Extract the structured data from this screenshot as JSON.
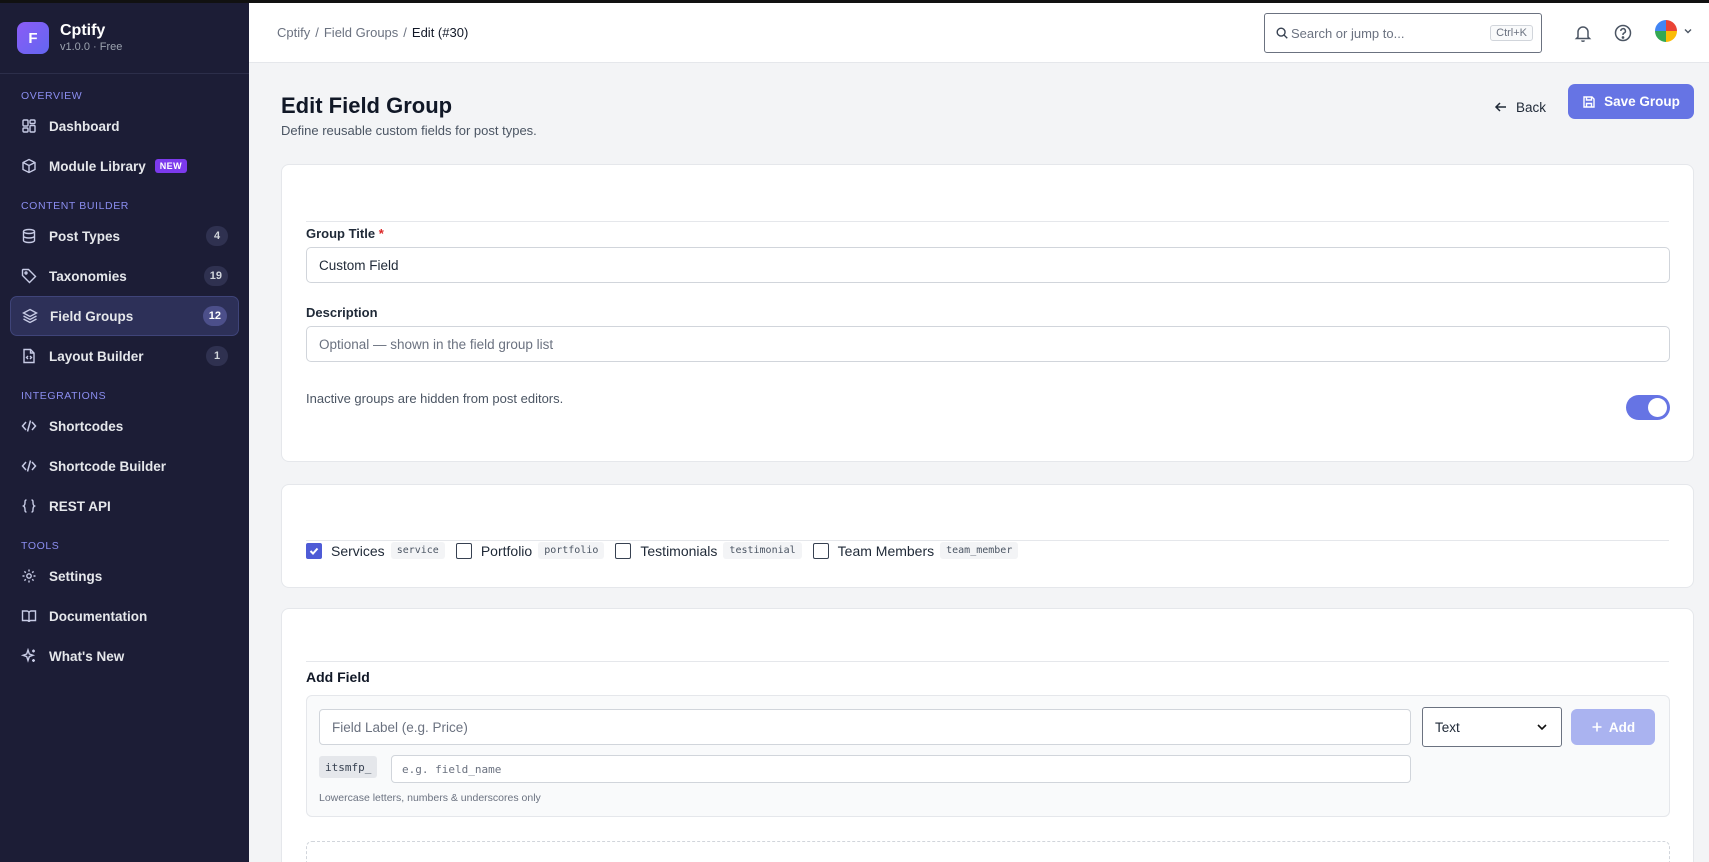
{
  "brand": {
    "logo_letter": "F",
    "name": "Cptify",
    "version": "v1.0.0 · Free"
  },
  "sidebar": {
    "sections": {
      "overview": "OVERVIEW",
      "content_builder": "CONTENT BUILDER",
      "integrations": "INTEGRATIONS",
      "tools": "TOOLS"
    },
    "items": {
      "dashboard": {
        "label": "Dashboard"
      },
      "module_library": {
        "label": "Module Library",
        "badge": "NEW"
      },
      "post_types": {
        "label": "Post Types",
        "count": "4"
      },
      "taxonomies": {
        "label": "Taxonomies",
        "count": "19"
      },
      "field_groups": {
        "label": "Field Groups",
        "count": "12"
      },
      "layout_builder": {
        "label": "Layout Builder",
        "count": "1"
      },
      "shortcodes": {
        "label": "Shortcodes"
      },
      "shortcode_builder": {
        "label": "Shortcode Builder"
      },
      "rest_api": {
        "label": "REST API"
      },
      "settings": {
        "label": "Settings"
      },
      "documentation": {
        "label": "Documentation"
      },
      "whats_new": {
        "label": "What's New"
      }
    }
  },
  "topbar": {
    "breadcrumbs": [
      "Cptify",
      "/",
      "Field Groups",
      "/",
      "Edit (#30)"
    ],
    "search_placeholder": "Search or jump to...",
    "search_shortcut": "Ctrl+K"
  },
  "page": {
    "title": "Edit Field Group",
    "subtitle": "Define reusable custom fields for post types.",
    "back_label": "Back",
    "save_label": "Save Group"
  },
  "general": {
    "group_title_label": "Group Title",
    "required_mark": "*",
    "group_title_value": "Custom Field",
    "description_label": "Description",
    "description_placeholder": "Optional — shown in the field group list",
    "active_hint": "Inactive groups are hidden from post editors.",
    "active": true
  },
  "post_types": [
    {
      "label": "Services",
      "slug": "service",
      "checked": true
    },
    {
      "label": "Portfolio",
      "slug": "portfolio",
      "checked": false
    },
    {
      "label": "Testimonials",
      "slug": "testimonial",
      "checked": false
    },
    {
      "label": "Team Members",
      "slug": "team_member",
      "checked": false
    }
  ],
  "add_field": {
    "title": "Add Field",
    "label_placeholder": "Field Label (e.g. Price)",
    "type_value": "Text",
    "add_label": "Add",
    "prefix": "itsmfp_",
    "key_placeholder": "e.g. field_name",
    "key_hint": "Lowercase letters, numbers & underscores only"
  },
  "colors": {
    "accent": "#6674e4",
    "sidebar_bg": "#1c1d36",
    "new_badge": "#7c3aed"
  }
}
